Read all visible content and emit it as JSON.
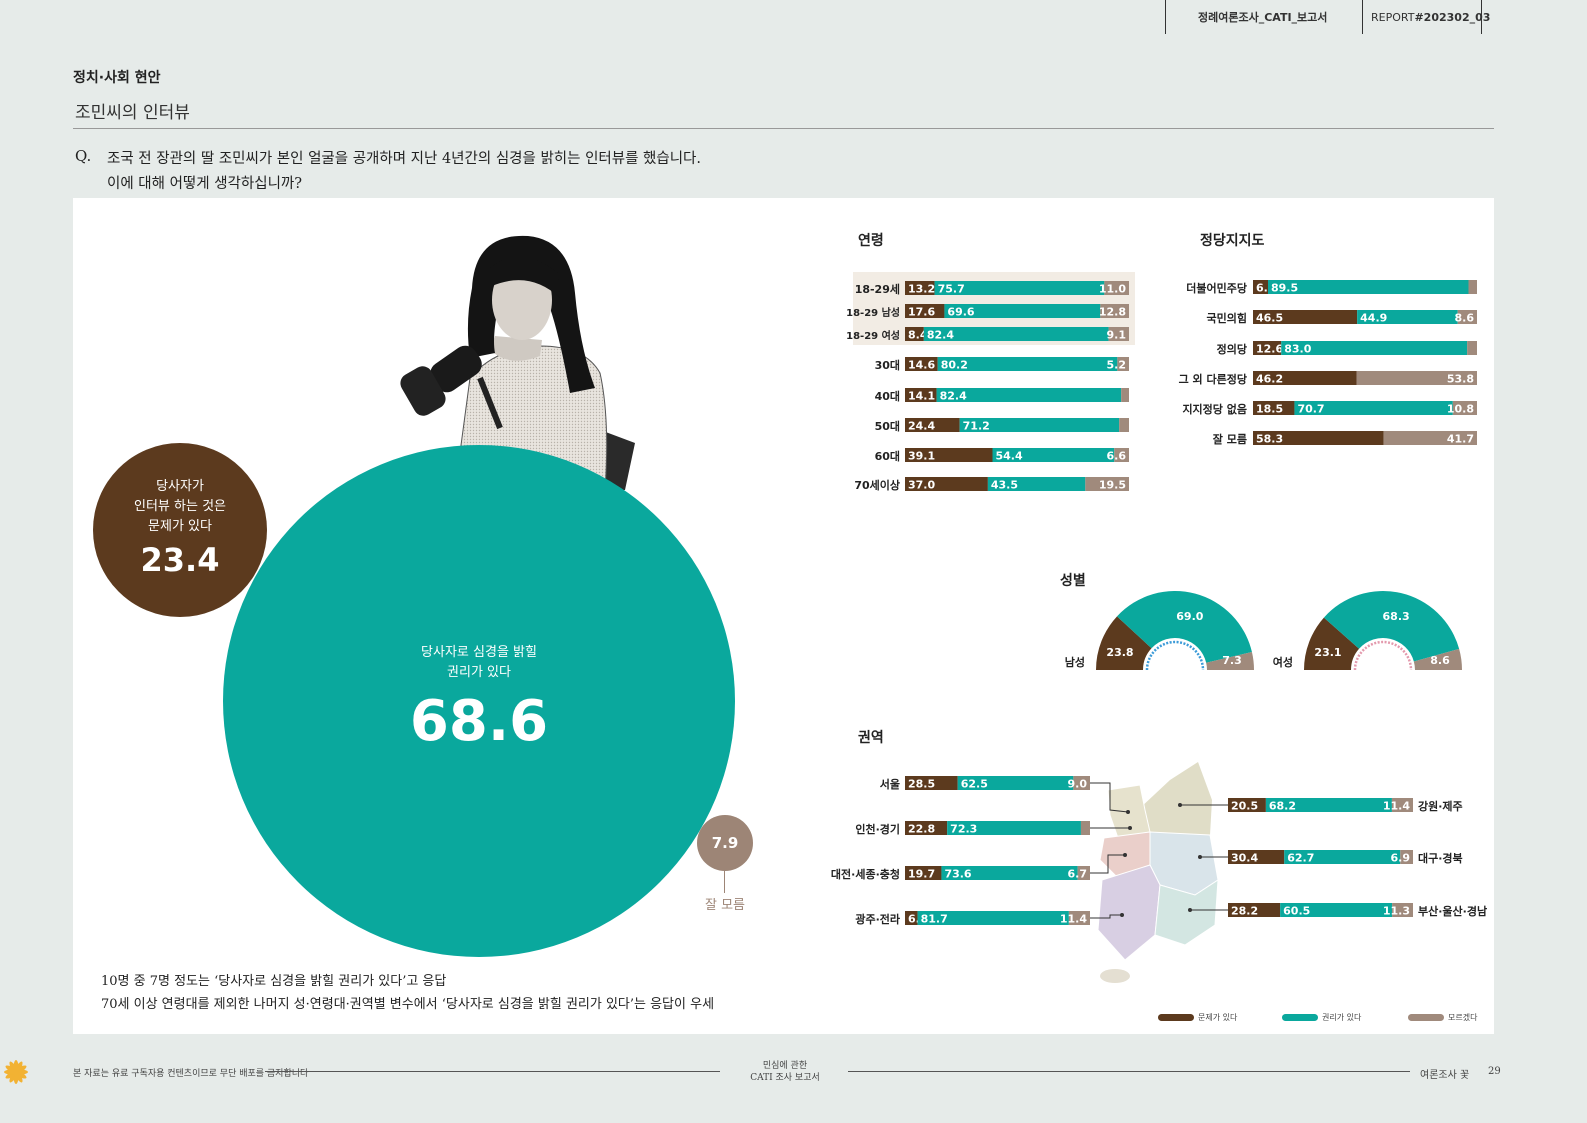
{
  "header": {
    "report_title": "정례여론조사_CATI_보고서",
    "report_code_prefix": "REPORT ",
    "report_code": "#202302_03"
  },
  "section": "정치·사회 현안",
  "subtitle": "조민씨의 인터뷰",
  "question": {
    "mark": "Q.",
    "line1": "조국 전 장관의 딸 조민씨가 본인 얼굴을 공개하며 지난 4년간의 심경을 밝히는 인터뷰를 했습니다.",
    "line2": "이에 대해 어떻게 생각하십니까?"
  },
  "overall": {
    "main": {
      "label1": "당사자로 심경을 밝힐",
      "label2": "권리가 있다",
      "value": "68.6"
    },
    "problem": {
      "label1": "당사자가",
      "label2": "인터뷰 하는 것은",
      "label3": "문제가 있다",
      "value": "23.4"
    },
    "unknown": {
      "value": "7.9",
      "label": "잘 모름"
    }
  },
  "notes": [
    "10명 중 7명 정도는 ‘당사자로 심경을 밝힐 권리가 있다’고 응답",
    "70세 이상 연령대를 제외한 나머지 성·연령대·권역별 변수에서 ‘당사자로 심경을 밝힐 권리가 있다’는 응답이 우세"
  ],
  "colors": {
    "problem": "#5c3a1e",
    "right": "#0aa89d",
    "unknown": "#a08a7c"
  },
  "chart_data": [
    {
      "type": "bar",
      "title": "연령",
      "stacked": true,
      "categories": [
        "18-29세",
        "18-29 남성",
        "18-29 여성",
        "30대",
        "40대",
        "50대",
        "60대",
        "70세이상"
      ],
      "series": [
        {
          "values": [
            13.2,
            17.6,
            8.4,
            14.6,
            14.1,
            24.4,
            39.1,
            37.0
          ]
        },
        {
          "values": [
            75.7,
            69.6,
            82.4,
            80.2,
            82.4,
            71.2,
            54.4,
            43.5
          ]
        },
        {
          "values": [
            11.0,
            12.8,
            9.1,
            5.2,
            3.5,
            4.4,
            6.6,
            19.5
          ]
        }
      ],
      "labels": [
        [
          "13.2",
          "75.7",
          "11.0"
        ],
        [
          "17.6",
          "69.6",
          "12.8"
        ],
        [
          "8.4",
          "82.4",
          "9.1"
        ],
        [
          "14.6",
          "80.2",
          "5.2"
        ],
        [
          "14.1",
          "82.4",
          ""
        ],
        [
          "24.4",
          "71.2",
          ""
        ],
        [
          "39.1",
          "54.4",
          "6.6"
        ],
        [
          "37.0",
          "43.5",
          "19.5"
        ]
      ]
    },
    {
      "type": "bar",
      "title": "정당지지도",
      "stacked": true,
      "categories": [
        "더불어민주당",
        "국민의힘",
        "정의당",
        "그 외 다른정당",
        "지지정당 없음",
        "잘 모름"
      ],
      "series": [
        {
          "values": [
            6.7,
            46.5,
            12.6,
            46.2,
            18.5,
            58.3
          ]
        },
        {
          "values": [
            89.5,
            44.9,
            83.0,
            0,
            70.7,
            0
          ]
        },
        {
          "values": [
            3.8,
            8.6,
            4.4,
            53.8,
            10.8,
            41.7
          ]
        }
      ],
      "labels": [
        [
          "6.7",
          "89.5",
          ""
        ],
        [
          "46.5",
          "44.9",
          "8.6"
        ],
        [
          "12.6",
          "83.0",
          ""
        ],
        [
          "46.2",
          "",
          "53.8"
        ],
        [
          "18.5",
          "70.7",
          "10.8"
        ],
        [
          "58.3",
          "",
          "41.7"
        ]
      ]
    },
    {
      "type": "pie",
      "title": "성별",
      "charts": [
        {
          "name": "남성",
          "values": [
            23.8,
            69.0,
            7.3
          ],
          "labels": [
            "23.8",
            "69.0",
            "7.3"
          ]
        },
        {
          "name": "여성",
          "values": [
            23.1,
            68.3,
            8.6
          ],
          "labels": [
            "23.1",
            "68.3",
            "8.6"
          ]
        }
      ]
    },
    {
      "type": "bar",
      "title": "권역",
      "stacked": true,
      "categories": [
        "서울",
        "인천·경기",
        "대전·세종·충청",
        "광주·전라",
        "강원·제주",
        "대구·경북",
        "부산·울산·경남"
      ],
      "series": [
        {
          "values": [
            28.5,
            22.8,
            19.7,
            6.8,
            20.5,
            30.4,
            28.2
          ]
        },
        {
          "values": [
            62.5,
            72.3,
            73.6,
            81.7,
            68.2,
            62.7,
            60.5
          ]
        },
        {
          "values": [
            9.0,
            4.9,
            6.7,
            11.4,
            11.4,
            6.9,
            11.3
          ]
        }
      ],
      "labels": [
        [
          "28.5",
          "62.5",
          "9.0"
        ],
        [
          "22.8",
          "72.3",
          ""
        ],
        [
          "19.7",
          "73.6",
          "6.7"
        ],
        [
          "6.8",
          "81.7",
          "11.4"
        ],
        [
          "20.5",
          "68.2",
          "11.4"
        ],
        [
          "30.4",
          "62.7",
          "6.9"
        ],
        [
          "28.2",
          "60.5",
          "11.3"
        ]
      ]
    }
  ],
  "legend": [
    "문제가 있다",
    "권리가 있다",
    "모르겠다"
  ],
  "footer": {
    "left": "본 자료는 유료 구독자용 컨텐츠이므로 무단 배포를 금지합니다",
    "center1": "민심에 관한",
    "center2": "CATI 조사 보고서",
    "right": "여론조사 꽃",
    "page": "29"
  }
}
